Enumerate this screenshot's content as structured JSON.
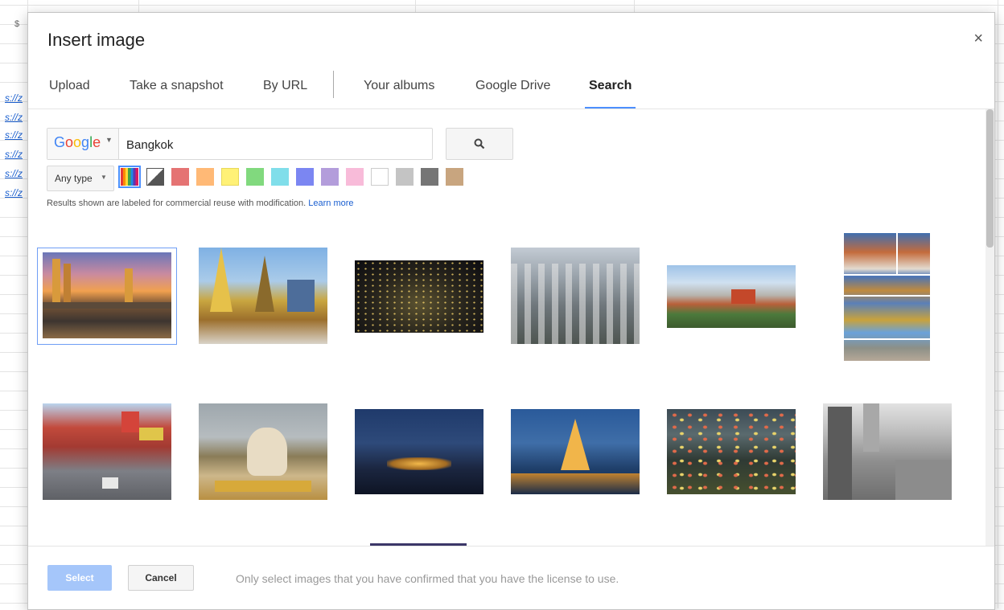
{
  "background": {
    "cell_dollar": "$",
    "links": [
      "s://z",
      "s://z",
      "s://z",
      "s://z",
      "s://z",
      "s://z"
    ]
  },
  "dialog": {
    "title": "Insert image",
    "close_glyph": "×",
    "tabs": [
      {
        "label": "Upload",
        "active": false
      },
      {
        "label": "Take a snapshot",
        "active": false
      },
      {
        "label": "By URL",
        "active": false
      },
      {
        "label": "Your albums",
        "active": false
      },
      {
        "label": "Google Drive",
        "active": false
      },
      {
        "label": "Search",
        "active": true
      }
    ],
    "search": {
      "engine": "Google",
      "query": "Bangkok",
      "button_icon": "search-icon"
    },
    "filters": {
      "type_label": "Any type",
      "colors": [
        "any-color",
        "black-and-white",
        "#e57373",
        "#ffb976",
        "#fff176",
        "#81d97e",
        "#80deea",
        "#7b86f2",
        "#b39ddb",
        "#f8bbd9",
        "#ffffff",
        "#c4c4c4",
        "#757575",
        "#c8a57f"
      ],
      "selected_color": "any-color"
    },
    "notice": {
      "text": "Results shown are labeled for commercial reuse with modification. ",
      "link": "Learn more"
    },
    "results": [
      {
        "name": "bangkok-skyline-sunset",
        "selected": true
      },
      {
        "name": "grand-palace-temple",
        "selected": false
      },
      {
        "name": "city-lights-night",
        "selected": false
      },
      {
        "name": "aerial-cityscape",
        "selected": false
      },
      {
        "name": "temple-panorama",
        "selected": false
      },
      {
        "name": "temple-collage",
        "selected": false
      },
      {
        "name": "chinatown-street",
        "selected": false
      },
      {
        "name": "elephant-statue-palace",
        "selected": false
      },
      {
        "name": "palace-night-view",
        "selected": false
      },
      {
        "name": "wat-arun-night",
        "selected": false
      },
      {
        "name": "floating-market",
        "selected": false
      },
      {
        "name": "bw-cityscape",
        "selected": false
      }
    ],
    "footer": {
      "select_label": "Select",
      "cancel_label": "Cancel",
      "note": "Only select images that you have confirmed that you have the license to use."
    }
  }
}
